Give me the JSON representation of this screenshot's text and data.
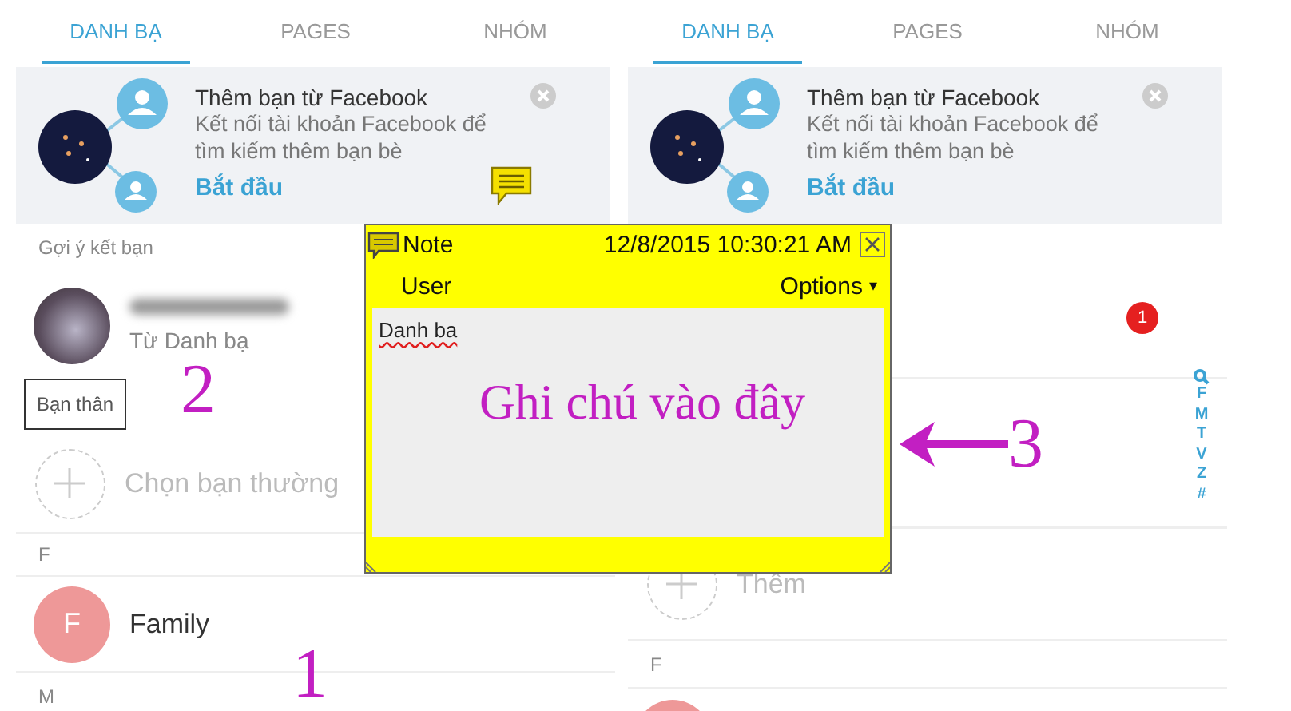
{
  "panels": [
    {
      "tabs": [
        {
          "label": "DANH BẠ",
          "selected": true
        },
        {
          "label": "PAGES",
          "selected": false
        },
        {
          "label": "NHÓM",
          "selected": false
        }
      ],
      "banner": {
        "title": "Thêm bạn từ Facebook",
        "description": "Kết nối tài khoản Facebook để tìm kiếm thêm bạn bè",
        "action": "Bắt đầu",
        "note_marker": true
      },
      "items": [
        {
          "kind": "header",
          "text": "Gợi ý kết bạn"
        },
        {
          "kind": "contact",
          "blurred_name": true,
          "subtitle": "Từ Danh bạ"
        },
        {
          "kind": "group_label",
          "text": "Bạn thân"
        },
        {
          "kind": "add",
          "text": "Chọn bạn thường"
        },
        {
          "kind": "header",
          "text": "F"
        },
        {
          "kind": "contact",
          "initial": "F",
          "name": "Family"
        },
        {
          "kind": "header",
          "text": "M"
        }
      ]
    },
    {
      "tabs": [
        {
          "label": "DANH BẠ",
          "selected": true
        },
        {
          "label": "PAGES",
          "selected": false
        },
        {
          "label": "NHÓM",
          "selected": false
        }
      ],
      "banner": {
        "title": "Thêm bạn từ Facebook",
        "description": "Kết nối tài khoản Facebook để tìm kiếm thêm bạn bè",
        "action": "Bắt đầu",
        "note_marker": false
      },
      "items": [
        {
          "kind": "badge_row",
          "badge": "1"
        },
        {
          "kind": "index_row",
          "letters": [
            "F",
            "M",
            "T",
            "V",
            "Z",
            "#"
          ]
        },
        {
          "kind": "add",
          "text": "Thêm"
        },
        {
          "kind": "header",
          "text": "F"
        },
        {
          "kind": "partial_avatar"
        }
      ]
    }
  ],
  "note": {
    "title": "Note",
    "date": "12/8/2015 10:30:21 AM",
    "user": "User",
    "options": "Options",
    "options_caret": "▾",
    "heading": "Danh ba",
    "body": "Ghi chú vào đây"
  },
  "annotations": [
    {
      "text": "2"
    },
    {
      "text": "1"
    },
    {
      "text": "3",
      "arrow": true
    }
  ]
}
